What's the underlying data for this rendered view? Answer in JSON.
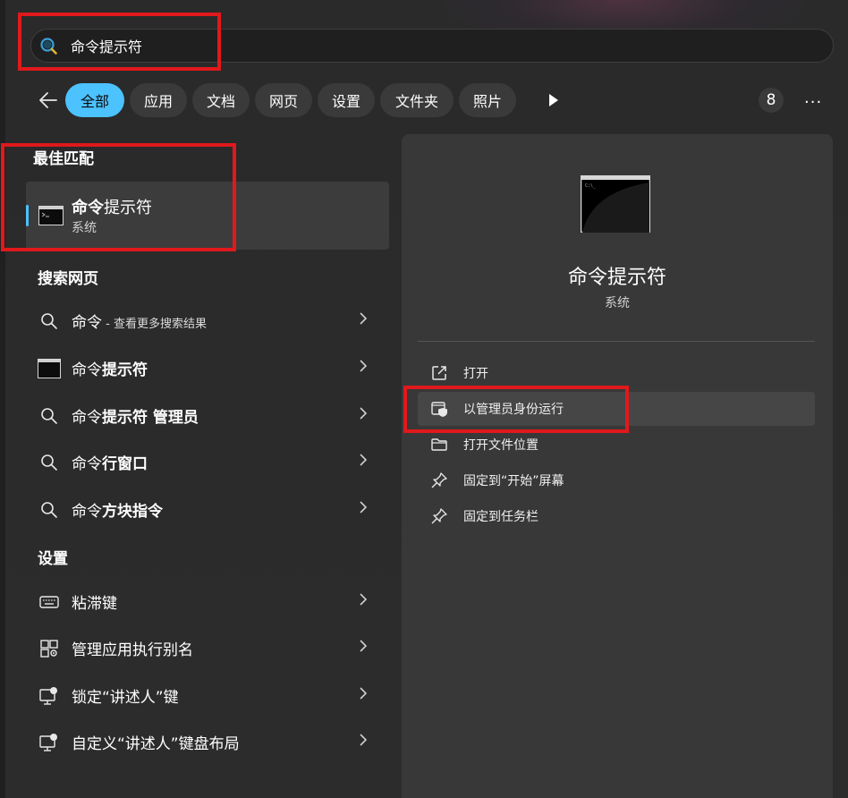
{
  "search": {
    "value": "命令提示符"
  },
  "filters": {
    "chips": [
      "全部",
      "应用",
      "文档",
      "网页",
      "设置",
      "文件夹",
      "照片"
    ],
    "count": "8",
    "more": "···"
  },
  "best_match": {
    "section_label": "最佳匹配",
    "title_bold": "命令",
    "title_rest": "提示符",
    "subtitle": "系统"
  },
  "web_search": {
    "section_label": "搜索网页",
    "items": [
      {
        "plain": "命令",
        "bold": "",
        "small": " - 查看更多搜索结果",
        "icon": "search-icon"
      },
      {
        "plain": "命令",
        "bold": "提示符",
        "small": "",
        "icon": "cmd-icon"
      },
      {
        "plain": "命令",
        "bold": "提示符 管理员",
        "small": "",
        "icon": "search-icon"
      },
      {
        "plain": "命令",
        "bold": "行窗口",
        "small": "",
        "icon": "search-icon"
      },
      {
        "plain": "命令",
        "bold": "方块指令",
        "small": "",
        "icon": "search-icon"
      }
    ]
  },
  "settings": {
    "section_label": "设置",
    "items": [
      {
        "label": "粘滞键",
        "icon": "keyboard-icon"
      },
      {
        "label": "管理应用执行别名",
        "icon": "app-settings-icon"
      },
      {
        "label": "锁定“讲述人”键",
        "icon": "narrator-icon"
      },
      {
        "label": "自定义“讲述人”键盘布局",
        "icon": "narrator-icon"
      }
    ]
  },
  "detail": {
    "title": "命令提示符",
    "subtitle": "系统",
    "actions": [
      {
        "label": "打开",
        "icon": "open-external-icon"
      },
      {
        "label": "以管理员身份运行",
        "icon": "shield-icon"
      },
      {
        "label": "打开文件位置",
        "icon": "folder-icon"
      },
      {
        "label": "固定到“开始”屏幕",
        "icon": "pin-icon"
      },
      {
        "label": "固定到任务栏",
        "icon": "pin-icon"
      }
    ]
  },
  "colors": {
    "accent": "#4cc2ff",
    "highlight_box": "#e0191c",
    "background": "#2a2a2a",
    "pane": "#383838"
  }
}
